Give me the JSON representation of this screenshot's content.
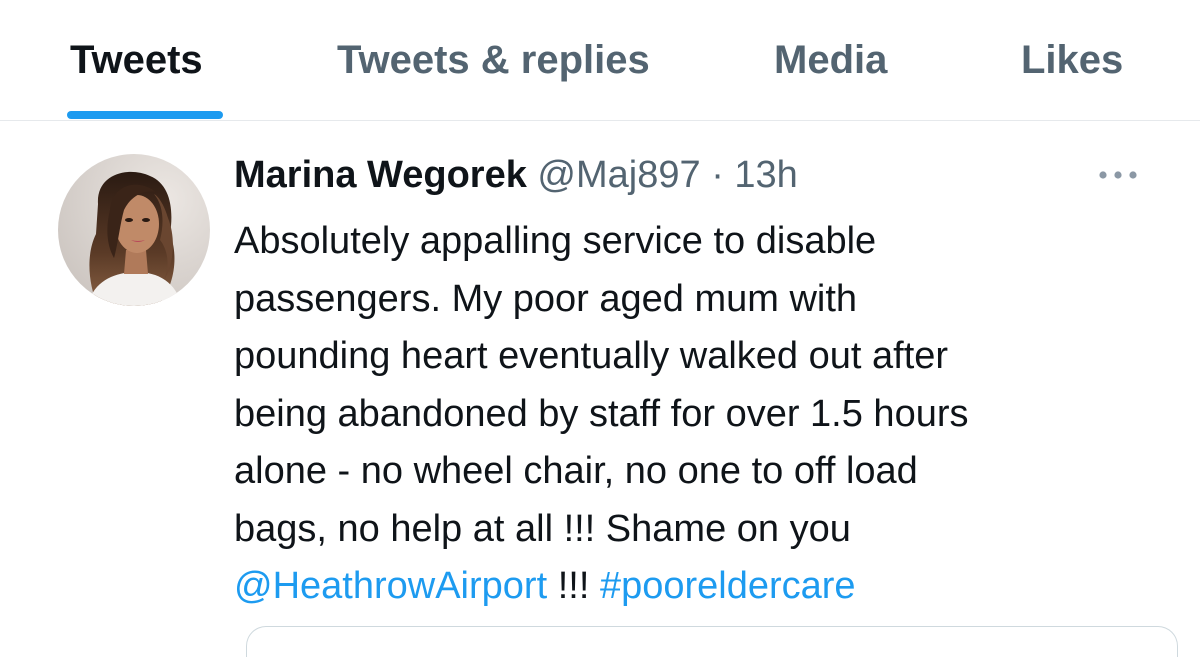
{
  "tabs": [
    {
      "label": "Tweets",
      "active": true
    },
    {
      "label": "Tweets & replies",
      "active": false
    },
    {
      "label": "Media",
      "active": false
    },
    {
      "label": "Likes",
      "active": false
    }
  ],
  "tweet": {
    "display_name": "Marina Wegorek",
    "handle": "@Maj897",
    "separator": "·",
    "time": "13h",
    "more_icon": "more-horizontal-icon",
    "text_lines": [
      "Absolutely appalling service to disable",
      "passengers. My poor aged mum with",
      "pounding heart eventually walked out after",
      "being abandoned by staff for over 1.5 hours",
      "alone - no wheel chair, no one to off load",
      "bags, no help at all !!! Shame on you"
    ],
    "last_line": {
      "mention": "@HeathrowAirport",
      "middle": " !!! ",
      "hashtag": "#pooreldercare"
    }
  },
  "colors": {
    "accent": "#1d9bf0",
    "primary_text": "#0f1419",
    "secondary_text": "#536471",
    "border": "#e6e9ec"
  }
}
